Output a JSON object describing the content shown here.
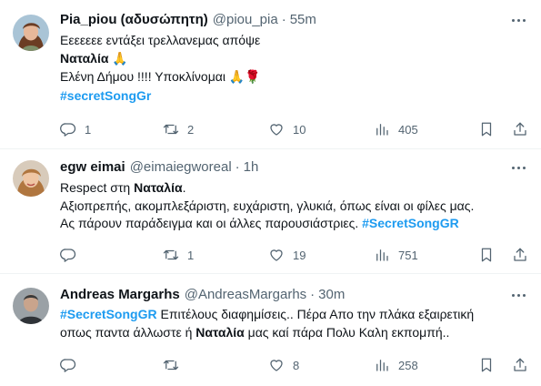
{
  "tweets": [
    {
      "name": "Pia_piou (αδυσώπητη)",
      "handle": "@piou_pia",
      "separator": "·",
      "time": "55m",
      "lines": {
        "l1": "Εεεεεεε εντάξει τρελλανεμας απόψε",
        "l2_bold": "Ναταλία",
        "l2_emoji": "🙏",
        "l3": "Ελένη Δήμου !!!! Υποκλίνομαι",
        "l3_emoji": "🙏🌹",
        "l4_hash": "#secretSongGr"
      },
      "stats": {
        "replies": "1",
        "retweets": "2",
        "likes": "10",
        "views": "405"
      },
      "avatar_colors": {
        "bg": "#a9c4d6",
        "hair": "#6b3d24",
        "skin": "#e7b89a"
      }
    },
    {
      "name": "egw eimai",
      "handle": "@eimaiegworeal",
      "separator": "·",
      "time": "1h",
      "lines": {
        "l1_pre": "Respect στη ",
        "l1_bold": "Ναταλία",
        "l1_post": ".",
        "l2": "Αξιοπρεπής, ακομπλεξάριστη, ευχάριστη, γλυκιά, όπως είναι οι φίλες μας.",
        "l3_pre": "Ας πάρουν παράδειγμα και οι άλλες παρουσιάστριες. ",
        "l3_hash": "#SecretSongGR"
      },
      "stats": {
        "replies": "",
        "retweets": "1",
        "likes": "19",
        "views": "751"
      },
      "avatar_colors": {
        "bg": "#d8cbbb",
        "hair": "#b0763f",
        "skin": "#efc6a4"
      }
    },
    {
      "name": "Andreas Margarhs",
      "handle": "@AndreasMargarhs",
      "separator": "·",
      "time": "30m",
      "lines": {
        "l1_hash": "#SecretSongGR",
        "l1_post": " Επιτέλους διαφημίσεις.. Πέρα Απο την πλάκα εξαιρετική",
        "l2_pre": "οπως παντα άλλωστε ή ",
        "l2_bold": "Ναταλία",
        "l2_post": " μας καί πάρα Πολυ Καλη εκπομπή.."
      },
      "stats": {
        "replies": "",
        "retweets": "",
        "likes": "8",
        "views": "258"
      },
      "avatar_colors": {
        "bg": "#9aa1a6",
        "hair": "#3a3a3a",
        "skin": "#c9a48c"
      }
    }
  ],
  "icons": {
    "reply": "reply-icon",
    "retweet": "retweet-icon",
    "like": "heart-icon",
    "views": "views-icon",
    "bookmark": "bookmark-icon",
    "share": "share-icon",
    "more": "more-icon"
  },
  "colors": {
    "accent": "#1d9bf0",
    "muted": "#536471",
    "text": "#0f1419",
    "divider": "#eff3f4"
  }
}
